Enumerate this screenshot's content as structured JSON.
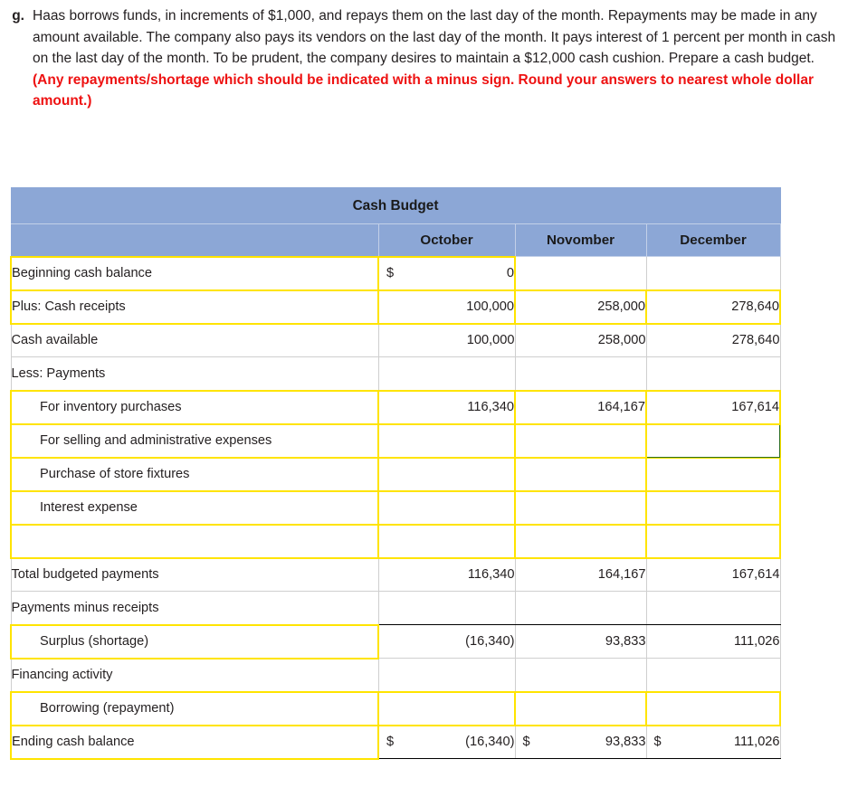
{
  "question": {
    "letter": "g.",
    "text_plain": "Haas borrows funds, in increments of $1,000, and repays them on the last day of the month. Repayments may be made in any amount available. The company also pays its vendors on the last day of the month. It pays interest of 1 percent per month in cash on the last day of the month. To be prudent, the company desires to maintain a $12,000 cash cushion. Prepare a cash budget. ",
    "text_red": "(Any repayments/shortage which should be indicated with a minus sign. Round your answers to nearest whole dollar amount.)",
    "red_color": "#ee1111"
  },
  "table": {
    "title": "Cash Budget",
    "header_bg": "#8ca7d6",
    "input_border": "#ffe400",
    "selected_border": "#2c6e1f",
    "columns": [
      "",
      "October",
      "Novomber",
      "December"
    ],
    "rows": [
      {
        "label": "Beginning cash balance",
        "label_input": true,
        "indent": false,
        "cells": [
          {
            "dollar": "$",
            "value": "0",
            "input": true
          },
          {
            "dollar": "",
            "value": "",
            "input": false
          },
          {
            "dollar": "",
            "value": "",
            "input": false
          }
        ]
      },
      {
        "label": "Plus: Cash receipts",
        "label_input": true,
        "indent": false,
        "cells": [
          {
            "dollar": "",
            "value": "100,000",
            "input": true
          },
          {
            "dollar": "",
            "value": "258,000",
            "input": true
          },
          {
            "dollar": "",
            "value": "278,640",
            "input": true
          }
        ]
      },
      {
        "label": "Cash available",
        "label_input": false,
        "indent": false,
        "rule": "top",
        "cells": [
          {
            "dollar": "",
            "value": "100,000",
            "input": false
          },
          {
            "dollar": "",
            "value": "258,000",
            "input": false
          },
          {
            "dollar": "",
            "value": "278,640",
            "input": false
          }
        ]
      },
      {
        "label": "Less: Payments",
        "label_input": false,
        "indent": false,
        "rule": "double",
        "cells": [
          {
            "dollar": "",
            "value": "",
            "input": false
          },
          {
            "dollar": "",
            "value": "",
            "input": false
          },
          {
            "dollar": "",
            "value": "",
            "input": false
          }
        ]
      },
      {
        "label": "For inventory purchases",
        "label_input": true,
        "indent": true,
        "cells": [
          {
            "dollar": "",
            "value": "116,340",
            "input": true
          },
          {
            "dollar": "",
            "value": "164,167",
            "input": true
          },
          {
            "dollar": "",
            "value": "167,614",
            "input": true
          }
        ]
      },
      {
        "label": "For selling and administrative expenses",
        "label_input": true,
        "indent": true,
        "cells": [
          {
            "dollar": "",
            "value": "",
            "input": true
          },
          {
            "dollar": "",
            "value": "",
            "input": true
          },
          {
            "dollar": "",
            "value": "",
            "input": true,
            "selected": true
          }
        ]
      },
      {
        "label": "Purchase of store fixtures",
        "label_input": true,
        "indent": true,
        "cells": [
          {
            "dollar": "",
            "value": "",
            "input": true
          },
          {
            "dollar": "",
            "value": "",
            "input": true
          },
          {
            "dollar": "",
            "value": "",
            "input": true
          }
        ]
      },
      {
        "label": "Interest expense",
        "label_input": true,
        "indent": true,
        "cells": [
          {
            "dollar": "",
            "value": "",
            "input": true
          },
          {
            "dollar": "",
            "value": "",
            "input": true
          },
          {
            "dollar": "",
            "value": "",
            "input": true
          }
        ]
      },
      {
        "label": "",
        "label_input": true,
        "indent": true,
        "cells": [
          {
            "dollar": "",
            "value": "",
            "input": true
          },
          {
            "dollar": "",
            "value": "",
            "input": true
          },
          {
            "dollar": "",
            "value": "",
            "input": true
          }
        ]
      },
      {
        "label": "Total budgeted payments",
        "label_input": false,
        "indent": false,
        "rule": "top",
        "cells": [
          {
            "dollar": "",
            "value": "116,340",
            "input": false
          },
          {
            "dollar": "",
            "value": "164,167",
            "input": false
          },
          {
            "dollar": "",
            "value": "167,614",
            "input": false
          }
        ]
      },
      {
        "label": "Payments minus receipts",
        "label_input": false,
        "indent": false,
        "rule": "double",
        "cells": [
          {
            "dollar": "",
            "value": "",
            "input": false
          },
          {
            "dollar": "",
            "value": "",
            "input": false
          },
          {
            "dollar": "",
            "value": "",
            "input": false
          }
        ]
      },
      {
        "label": "Surplus (shortage)",
        "label_input": true,
        "indent": true,
        "cells": [
          {
            "dollar": "",
            "value": "(16,340)",
            "input": false
          },
          {
            "dollar": "",
            "value": "93,833",
            "input": false
          },
          {
            "dollar": "",
            "value": "111,026",
            "input": false
          }
        ]
      },
      {
        "label": "Financing activity",
        "label_input": false,
        "indent": false,
        "cells": [
          {
            "dollar": "",
            "value": "",
            "input": false
          },
          {
            "dollar": "",
            "value": "",
            "input": false
          },
          {
            "dollar": "",
            "value": "",
            "input": false
          }
        ]
      },
      {
        "label": "Borrowing (repayment)",
        "label_input": true,
        "indent": true,
        "cells": [
          {
            "dollar": "",
            "value": "",
            "input": true
          },
          {
            "dollar": "",
            "value": "",
            "input": true
          },
          {
            "dollar": "",
            "value": "",
            "input": true
          }
        ]
      },
      {
        "label": "Ending cash balance",
        "label_input": true,
        "indent": false,
        "rule": "top-double",
        "cells": [
          {
            "dollar": "$",
            "value": "(16,340)",
            "input": false
          },
          {
            "dollar": "$",
            "value": "93,833",
            "input": false
          },
          {
            "dollar": "$",
            "value": "111,026",
            "input": false
          }
        ]
      }
    ]
  }
}
